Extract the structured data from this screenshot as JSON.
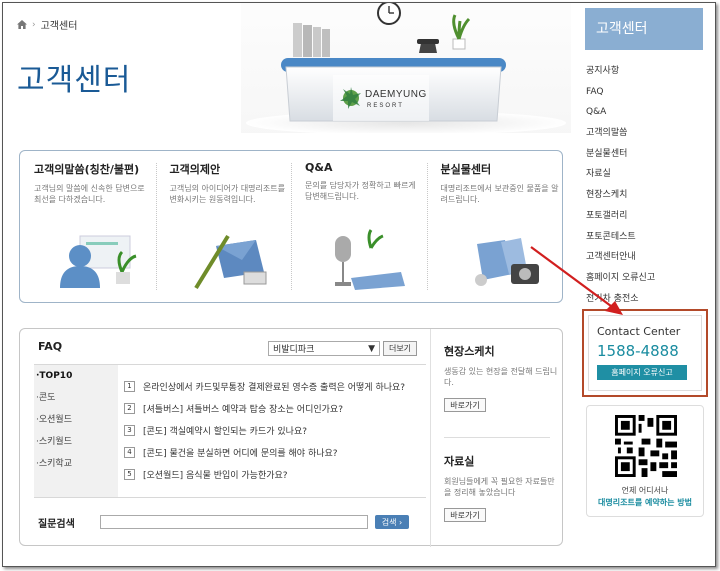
{
  "breadcrumb": {
    "current": "고객센터"
  },
  "page_title": "고객센터",
  "hero": {
    "brand_name": "DAEMYUNG",
    "brand_sub": "RESORT"
  },
  "quick_menu": [
    {
      "title": "고객의말씀(칭찬/불편)",
      "desc": "고객님의 말씀에 신속한 답변으로 최선을 다하겠습니다."
    },
    {
      "title": "고객의제안",
      "desc": "고객님의 아이디어가 대명리조트를 변화시키는 원동력입니다."
    },
    {
      "title": "Q&A",
      "desc": "문의를 담당자가 정확하고 빠르게 답변해드립니다."
    },
    {
      "title": "분실물센터",
      "desc": "대명리조트에서 보관중인 물품을 알려드립니다."
    }
  ],
  "faq": {
    "title": "FAQ",
    "select_value": "비발디파크",
    "more_label": "더보기",
    "categories": [
      "·TOP10",
      "·콘도",
      "·오션월드",
      "·스키월드",
      "·스키학교"
    ],
    "questions": [
      {
        "num": "1",
        "text": "온라인상에서 카드및무통장 결제완료된 영수증 출력은 어떻게 하나요?"
      },
      {
        "num": "2",
        "text": "[셔틀버스] 셔틀버스 예약과 탑승 장소는 어디인가요?"
      },
      {
        "num": "3",
        "text": "[콘도] 객실예약시 할인되는 카드가 있나요?"
      },
      {
        "num": "4",
        "text": "[콘도] 물건을 분실하면 어디에 문의를 해야 하나요?"
      },
      {
        "num": "5",
        "text": "[오션월드] 음식물 반입이 가능한가요?"
      }
    ],
    "search_label": "질문검색",
    "search_button": "검색 ›"
  },
  "side": {
    "sketch": {
      "title": "현장스케치",
      "desc": "생동감 있는 현장을 전달해 드립니다.",
      "button": "바로가기"
    },
    "archive": {
      "title": "자료실",
      "desc": "회원님들에게 꼭 필요한 자료들만을 정리해 놓았습니다",
      "button": "바로가기"
    }
  },
  "sidebar": {
    "title": "고객센터",
    "items": [
      "공지사항",
      "FAQ",
      "Q&A",
      "고객의말씀",
      "분실물센터",
      "자료실",
      "현장스케치",
      "포토갤러리",
      "포토콘테스트",
      "고객센터안내",
      "홈페이지 오류신고",
      "전기차 충전소"
    ]
  },
  "contact": {
    "label": "Contact Center",
    "number": "1588-4888",
    "button": "홈페이지 오류신고"
  },
  "qr": {
    "line1": "언제 어디서나",
    "line2": "대명리조트를 예약하는 방법"
  },
  "colors": {
    "title_blue": "#1a5a96",
    "sidebar_head": "#8aaed2",
    "contact_teal": "#1f8fa4",
    "annotation_red": "#d11f1f"
  }
}
